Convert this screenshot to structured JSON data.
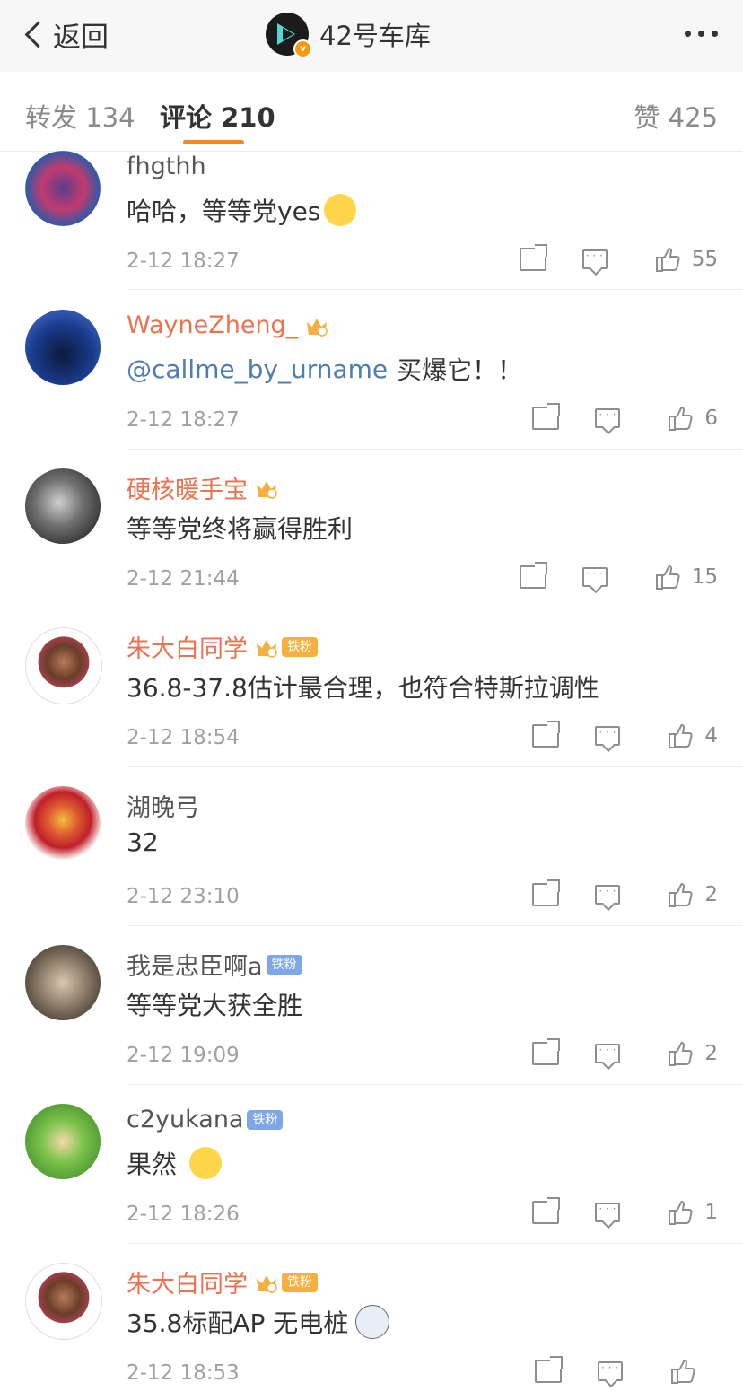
{
  "nav": {
    "back_label": "返回",
    "title": "42号车库",
    "verified_mark": "v"
  },
  "tabs": [
    {
      "label": "转发 134"
    },
    {
      "label": "评论 210",
      "active": true
    },
    {
      "label": "赞 425"
    }
  ],
  "colors": {
    "accent": "#f08a29",
    "username_vip": "#eb7350",
    "mention": "#507daf",
    "timestamp": "#a0a0a0",
    "badge_gold": "#f5b041",
    "badge_blue": "#7fa7e8"
  },
  "comments": [
    {
      "user": "fhgthh",
      "style": "gray",
      "mention": "",
      "text": "哈哈，等等党yes",
      "emoji": "covering-face-emoji",
      "time": "2-12 18:27",
      "likes": "55"
    },
    {
      "user": "WayneZheng_",
      "style": "orange",
      "crown": true,
      "mention": "@callme_by_urname",
      "text": "买爆它！！",
      "time": "2-12 18:27",
      "likes": "6"
    },
    {
      "user": "硬核暖手宝",
      "style": "orange",
      "crown": true,
      "mention": "",
      "text": "等等党终将赢得胜利",
      "time": "2-12 21:44",
      "likes": "15"
    },
    {
      "user": "朱大白同学",
      "style": "orange",
      "crown": true,
      "badge": "铁粉",
      "mention": "",
      "text": "36.8-37.8估计最合理，也符合特斯拉调性",
      "time": "2-12 18:54",
      "likes": "4"
    },
    {
      "user": "湖晚弓",
      "style": "gray",
      "mention": "",
      "text": "32",
      "time": "2-12 23:10",
      "likes": "2"
    },
    {
      "user": "我是忠臣啊a",
      "style": "gray",
      "badge": "铁粉",
      "badge_color": "blue",
      "mention": "",
      "text": "等等党大获全胜",
      "time": "2-12 19:09",
      "likes": "2"
    },
    {
      "user": "c2yukana",
      "style": "gray",
      "badge": "铁粉",
      "badge_color": "blue",
      "mention": "",
      "text": "果然",
      "emoji": "yummy-emoji",
      "time": "2-12 18:26",
      "likes": "1"
    },
    {
      "user": "朱大白同学",
      "style": "orange",
      "crown": true,
      "badge": "铁粉",
      "mention": "",
      "text": "35.8标配AP 无电桩",
      "emoji": "dog-emoji",
      "time": "2-12 18:53",
      "likes": ""
    }
  ]
}
